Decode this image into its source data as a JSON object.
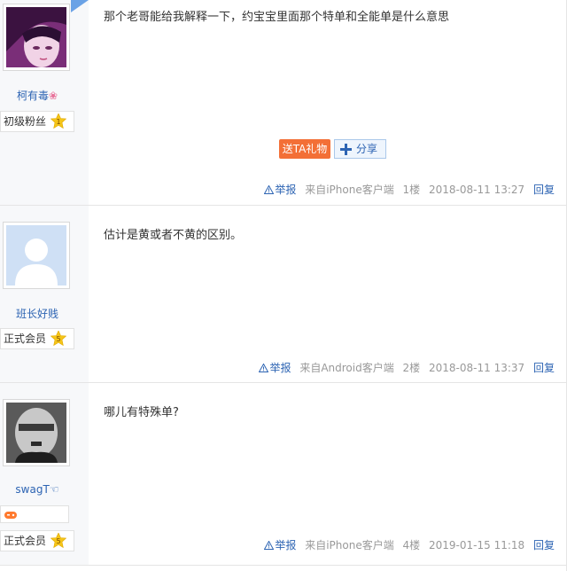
{
  "posts": [
    {
      "username": "柯有毒",
      "username_suffix": "❀",
      "title_badge": "初级粉丝",
      "level": "1",
      "content": "那个老哥能给我解释一下，约宝宝里面那个特单和全能单是什么意思",
      "gift_label": "送TA礼物",
      "share_label": "分享",
      "report": "举报",
      "client": "来自iPhone客户端",
      "floor": "1楼",
      "time": "2018-08-11 13:27",
      "reply": "回复"
    },
    {
      "username": "班长好贱",
      "title_badge": "正式会员",
      "level": "5",
      "content": "估计是黄或者不黄的区别。",
      "report": "举报",
      "client": "来自Android客户端",
      "floor": "2楼",
      "time": "2018-08-11 13:37",
      "reply": "回复"
    },
    {
      "username": "swagT",
      "username_suffix": "☜",
      "title_badge": "正式会员",
      "level": "5",
      "content": "哪儿有特殊单?",
      "report": "举报",
      "client": "来自iPhone客户端",
      "floor": "4楼",
      "time": "2019-01-15 11:18",
      "reply": "回复"
    }
  ],
  "colors": {
    "link": "#2d64b3",
    "gift": "#f36f36",
    "star": "#f5c518"
  },
  "icons": [
    "warning-icon",
    "plus-icon",
    "level-star-icon",
    "game-controller-icon"
  ]
}
